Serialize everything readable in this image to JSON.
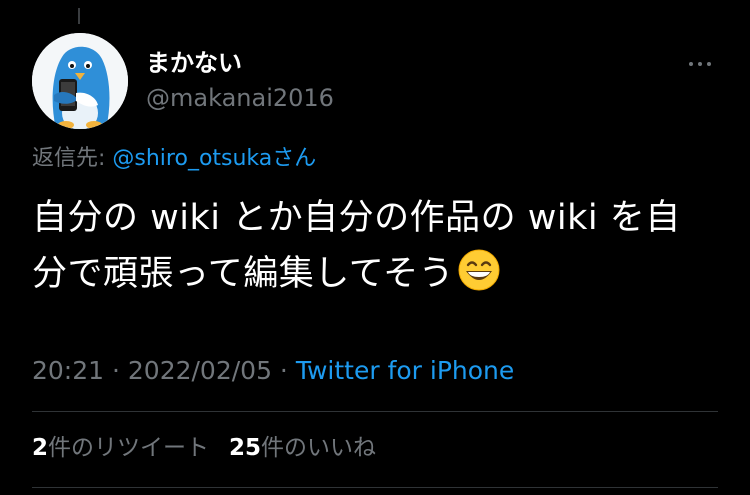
{
  "tweet": {
    "author": {
      "display_name": "まかない",
      "handle": "@makanai2016"
    },
    "reply_to": {
      "prefix": "返信先: ",
      "mention": "@shiro_otsuka",
      "honorific": "さん"
    },
    "text_line1": "自分の wiki とか自分の作品の wiki を自",
    "text_line2": "分で頑張って編集してそう",
    "emoji": "grinning-face-with-smiling-eyes",
    "time": "20:21",
    "date": "2022/02/05",
    "separator": " · ",
    "source": "Twitter for iPhone"
  },
  "stats": {
    "retweets_count": "2",
    "retweets_label": "件のリツイート",
    "likes_count": "25",
    "likes_label": "件のいいね"
  },
  "colors": {
    "background": "#000000",
    "text_primary": "#ffffff",
    "text_secondary": "#71767b",
    "link": "#1d9bf0",
    "divider": "#2f3336",
    "avatar_bird": "#2f8fd8"
  },
  "icons": {
    "more": "more-horizontal-icon",
    "emoji": "grinning-face-emoji-icon"
  }
}
